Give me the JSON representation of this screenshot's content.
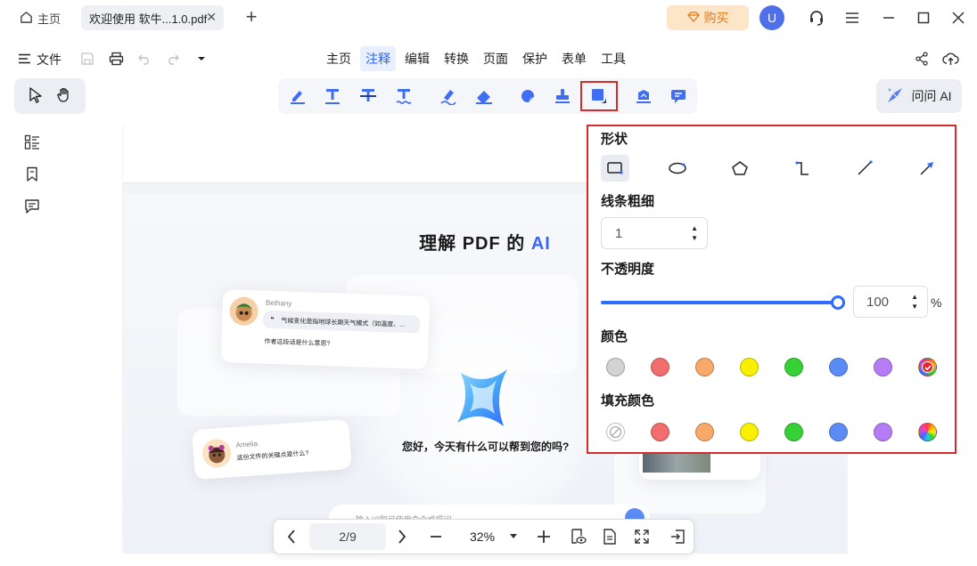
{
  "titlebar": {
    "home_tab": "主页",
    "doc_tab": "欢迎使用 软牛...1.0.pdf",
    "buy_label": "购买",
    "avatar_letter": "U"
  },
  "menubar": {
    "file_label": "文件",
    "items": [
      "主页",
      "注释",
      "编辑",
      "转换",
      "页面",
      "保护",
      "表单",
      "工具"
    ],
    "active_item": "注释"
  },
  "toolbar": {
    "ask_ai_label": "问问 AI",
    "annotation_tools": [
      "highlight",
      "text-underline",
      "text-strikethrough",
      "text-squiggly",
      "marker",
      "eraser",
      "sticker",
      "stamp",
      "shape",
      "signature",
      "text-box"
    ],
    "selected_tool": "shape"
  },
  "document": {
    "title_prefix": "理解 PDF 的 ",
    "title_ai": "AI",
    "card1_name": "Bethany",
    "card1_quote": "气候变化是指地球长期天气模式（如温度、...",
    "card1_question": "作者这段话是什么意思?",
    "card2_name": "Amelia",
    "card2_question": "这份文件的关键点是什么?",
    "greeting": "您好，今天有什么可以帮到您的吗?",
    "input_hint": "输入“/”即可使用命令或提问"
  },
  "bottom_nav": {
    "page_indicator": "2/9",
    "zoom": "32%"
  },
  "shape_panel": {
    "shape_label": "形状",
    "shapes": [
      "rectangle",
      "ellipse",
      "polygon",
      "polyline",
      "line",
      "arrow"
    ],
    "selected_shape": "rectangle",
    "line_width_label": "线条粗细",
    "line_width": "1",
    "opacity_label": "不透明度",
    "opacity": "100",
    "opacity_unit": "%",
    "opacity_fraction": 1.0,
    "color_label": "颜色",
    "colors": [
      "#d3d3d3",
      "#f26d6d",
      "#f8a868",
      "#f8f000",
      "#35d136",
      "#5b8cf5",
      "#b57cf5",
      "#e8232b"
    ],
    "selected_color": "#e8232b",
    "fill_label": "填充颜色",
    "fill_colors": [
      "none",
      "#f26d6d",
      "#f8a868",
      "#f8f000",
      "#35d136",
      "#5b8cf5",
      "#b57cf5",
      "rainbow"
    ]
  },
  "colors": {
    "accent": "#2f6bff",
    "highlight_outline": "#d62b2b",
    "buy_bg": "#fde6c8",
    "buy_fg": "#e07b1a"
  }
}
